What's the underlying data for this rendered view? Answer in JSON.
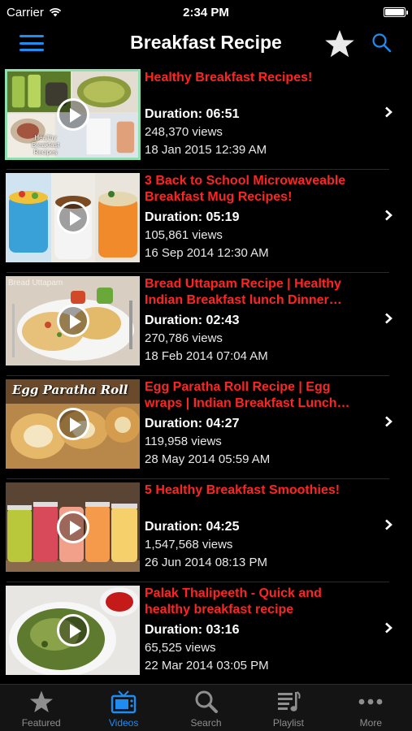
{
  "status": {
    "carrier": "Carrier",
    "time": "2:34 PM"
  },
  "nav": {
    "title": "Breakfast Recipe"
  },
  "colors": {
    "accent": "#1f8cf2",
    "title_red": "#ff2424",
    "background": "#000000",
    "selected_border": "#8fe0b0"
  },
  "videos": [
    {
      "title_lines": [
        "Healthy Breakfast Recipes!",
        ""
      ],
      "duration": "Duration: 06:51",
      "views": "248,370 views",
      "date": "18 Jan 2015 12:39 AM",
      "thumb_caption": "Healthy\nBreakfast\nRecipes",
      "selected": true
    },
    {
      "title_lines": [
        "3 Back to School Microwaveable",
        "Breakfast Mug Recipes!"
      ],
      "duration": "Duration: 05:19",
      "views": "105,861 views",
      "date": "16 Sep 2014 12:30 AM",
      "thumb_caption": ""
    },
    {
      "title_lines": [
        "Bread Uttapam Recipe | Healthy",
        "Indian Breakfast lunch Dinner…"
      ],
      "duration": "Duration: 02:43",
      "views": "270,786 views",
      "date": "18 Feb 2014 07:04 AM",
      "thumb_caption": "Bread Uttapam"
    },
    {
      "title_lines": [
        "Egg Paratha Roll Recipe | Egg",
        "wraps | Indian Breakfast Lunch…"
      ],
      "duration": "Duration: 04:27",
      "views": "119,958 views",
      "date": "28 May 2014 05:59 AM",
      "thumb_caption": "Egg Paratha Roll"
    },
    {
      "title_lines": [
        "5 Healthy Breakfast Smoothies!",
        ""
      ],
      "duration": "Duration: 04:25",
      "views": "1,547,568 views",
      "date": "26 Jun 2014 08:13 PM",
      "thumb_caption": ""
    },
    {
      "title_lines": [
        "Palak Thalipeeth - Quick and",
        "healthy breakfast recipe"
      ],
      "duration": "Duration: 03:16",
      "views": "65,525 views",
      "date": "22 Mar 2014 03:05 PM",
      "thumb_caption": ""
    }
  ],
  "tabs": [
    {
      "label": "Featured",
      "icon": "star-icon"
    },
    {
      "label": "Videos",
      "icon": "tv-icon",
      "active": true
    },
    {
      "label": "Search",
      "icon": "search-icon"
    },
    {
      "label": "Playlist",
      "icon": "playlist-icon"
    },
    {
      "label": "More",
      "icon": "more-icon"
    }
  ]
}
